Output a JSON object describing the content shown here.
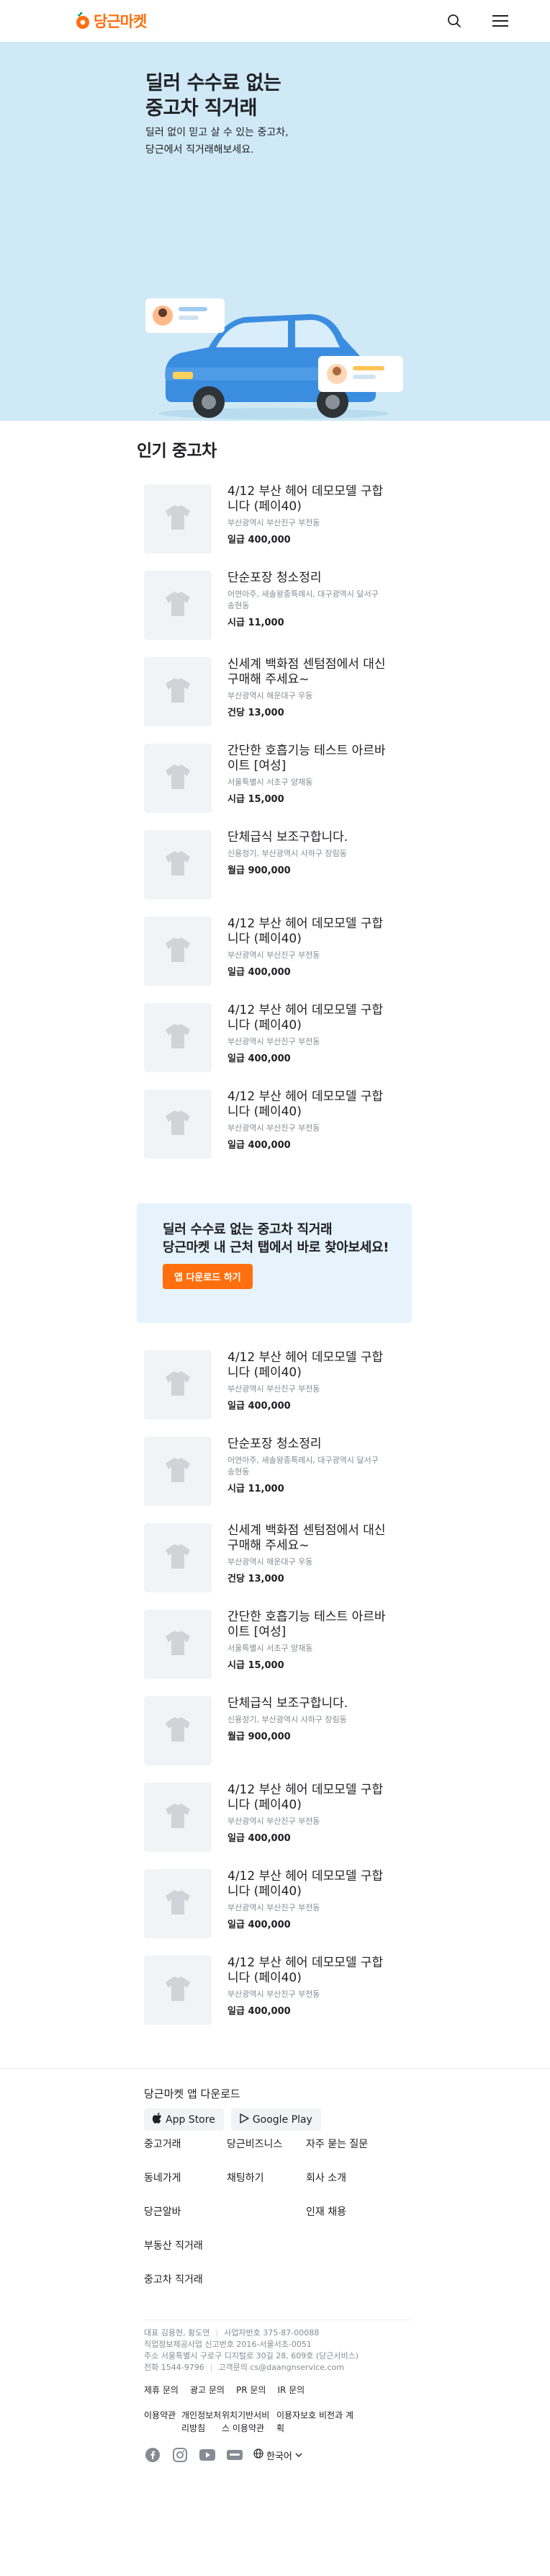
{
  "header": {
    "logo_text": "당근마켓"
  },
  "hero": {
    "title": "딜러 수수료 없는\n중고차 직거래",
    "subtitle": "딜러 없이 믿고 살 수 있는 중고차,\n당근에서 직거래해보세요."
  },
  "section": {
    "title": "인기 중고차"
  },
  "items_a": [
    {
      "title": "4/12 부산 헤어 데모모델 구합니다 (페이40)",
      "location": "부산광역시 부산진구 부전동",
      "price": "일급 400,000"
    },
    {
      "title": "단순포장 청소정리",
      "location": "어연아주, 새솔왕종특례시, 대구광역시 달서구 송현동",
      "price": "시급 11,000"
    },
    {
      "title": "신세계 백화점 센텀점에서 대신 구매해 주세요~",
      "location": "부산광역시 해운대구 우동",
      "price": "건당 13,000"
    },
    {
      "title": "간단한 호흡기능 테스트 아르바이트 [여성]",
      "location": "서울특별시 서초구 양재동",
      "price": "시급 15,000"
    },
    {
      "title": "단체급식 보조구합니다.",
      "location": "신용정기, 부산광역시 사하구 장림동",
      "price": "월급 900,000"
    },
    {
      "title": "4/12 부산 헤어 데모모델 구합니다 (페이40)",
      "location": "부산광역시 부산진구 부전동",
      "price": "일급 400,000"
    },
    {
      "title": "4/12 부산 헤어 데모모델 구합니다 (페이40)",
      "location": "부산광역시 부산진구 부전동",
      "price": "일급 400,000"
    },
    {
      "title": "4/12 부산 헤어 데모모델 구합니다 (페이40)",
      "location": "부산광역시 부산진구 부전동",
      "price": "일급 400,000"
    }
  ],
  "promo": {
    "text": "딜러 수수료 없는 중고차 직거래\n당근마켓 내 근처 탭에서 바로 찾아보세요!",
    "button": "앱 다운로드 하기"
  },
  "items_b": [
    {
      "title": "4/12 부산 헤어 데모모델 구합니다 (페이40)",
      "location": "부산광역시 부산진구 부전동",
      "price": "일급 400,000"
    },
    {
      "title": "단순포장 청소정리",
      "location": "어연아주, 새솔왕종특례시, 대구광역시 달서구 송현동",
      "price": "시급 11,000"
    },
    {
      "title": "신세계 백화점 센텀점에서 대신 구매해 주세요~",
      "location": "부산광역시 해운대구 우동",
      "price": "건당 13,000"
    },
    {
      "title": "간단한 호흡기능 테스트 아르바이트 [여성]",
      "location": "서울특별시 서초구 양재동",
      "price": "시급 15,000"
    },
    {
      "title": "단체급식 보조구합니다.",
      "location": "신용정기, 부산광역시 사하구 장림동",
      "price": "월급 900,000"
    },
    {
      "title": "4/12 부산 헤어 데모모델 구합니다 (페이40)",
      "location": "부산광역시 부산진구 부전동",
      "price": "일급 400,000"
    },
    {
      "title": "4/12 부산 헤어 데모모델 구합니다 (페이40)",
      "location": "부산광역시 부산진구 부전동",
      "price": "일급 400,000"
    },
    {
      "title": "4/12 부산 헤어 데모모델 구합니다 (페이40)",
      "location": "부산광역시 부산진구 부전동",
      "price": "일급 400,000"
    }
  ],
  "footer": {
    "app_title": "당근마켓 앱 다운로드",
    "app_store": "App Store",
    "google_play": "Google Play",
    "links": [
      "중고거래",
      "당근비즈니스",
      "자주 묻는 질문",
      "동네가게",
      "채팅하기",
      "회사 소개",
      "당근알바",
      "",
      "인재 채용",
      "부동산 직거래",
      "",
      "",
      "중고차 직거래",
      "",
      ""
    ],
    "biz_line1": "대표 김용현, 황도연",
    "biz_line1b": "사업자번호 375-87-00088",
    "biz_line2": "직업정보제공사업 신고번호 2016-서울서초-0051",
    "biz_line3": "주소 서울특별시 구로구 디지털로 30길 28, 609호 (당근서비스)",
    "biz_line4": "전화 1544-9796",
    "biz_line4b": "고객문의 cs@daangnservice.com",
    "policy1": [
      "제휴 문의",
      "광고 문의",
      "PR 문의",
      "IR 문의"
    ],
    "policy2": [
      "이용약관",
      "개인정보처리방침",
      "위치기반서비스 이용약관",
      "이용자보호 비전과 계획"
    ],
    "language": "한국어"
  },
  "colors": {
    "brand": "#ff6f0f",
    "hero_bg": "#cfe9f7",
    "promo_bg": "#e6f3fc",
    "thumb_bg": "#f2f3f6"
  }
}
